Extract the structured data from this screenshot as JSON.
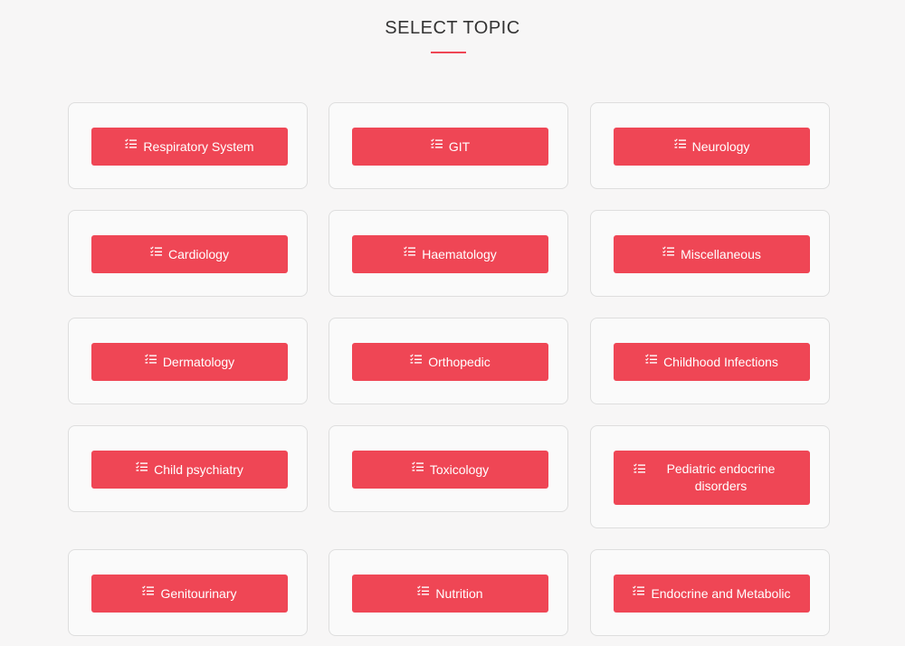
{
  "page": {
    "title": "SELECT TOPIC"
  },
  "topics": [
    "Respiratory System",
    "GIT",
    "Neurology",
    "Cardiology",
    "Haematology",
    "Miscellaneous",
    "Dermatology",
    "Orthopedic",
    "Childhood Infections",
    "Child psychiatry",
    "Toxicology",
    "Pediatric endocrine disorders",
    "Genitourinary",
    "Nutrition",
    "Endocrine and Metabolic"
  ],
  "icon": "list-check-icon",
  "colors": {
    "accent": "#ef4655",
    "background": "#f7f6f6",
    "card": "#fafafa"
  }
}
